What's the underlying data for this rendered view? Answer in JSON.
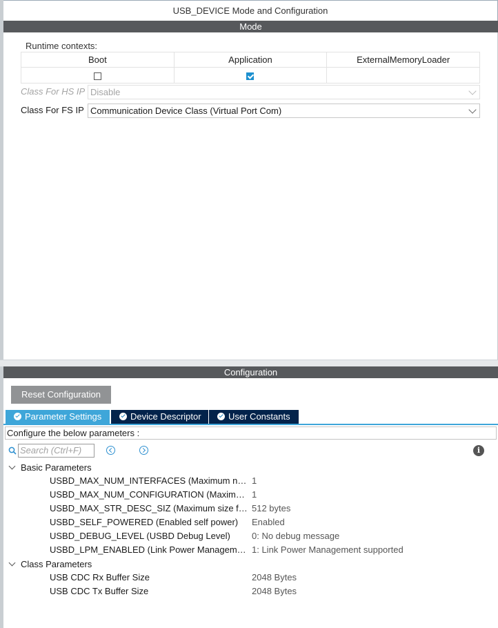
{
  "window": {
    "title": "USB_DEVICE Mode and Configuration"
  },
  "mode": {
    "header": "Mode",
    "runtime_label": "Runtime contexts:",
    "contexts": [
      {
        "label": "Boot",
        "checked": false
      },
      {
        "label": "Application",
        "checked": true
      },
      {
        "label": "ExternalMemoryLoader",
        "checked": null
      }
    ],
    "hs_label": "Class For HS IP",
    "hs_value": "Disable",
    "fs_label": "Class For FS IP",
    "fs_value": "Communication Device Class (Virtual Port Com)"
  },
  "config": {
    "header": "Configuration",
    "reset_label": "Reset Configuration",
    "tabs": [
      {
        "label": "Parameter Settings",
        "active": true
      },
      {
        "label": "Device Descriptor",
        "active": false
      },
      {
        "label": "User Constants",
        "active": false
      }
    ],
    "hint": "Configure the below parameters :",
    "search_placeholder": "Search (Ctrl+F)",
    "groups": [
      {
        "label": "Basic Parameters",
        "rows": [
          {
            "name": "USBD_MAX_NUM_INTERFACES (Maximum number of interfaces)",
            "value": "1"
          },
          {
            "name": "USBD_MAX_NUM_CONFIGURATION (Maximum number of configurations)",
            "value": "1"
          },
          {
            "name": "USBD_MAX_STR_DESC_SIZ (Maximum size for the string descriptors)",
            "value": "512 bytes"
          },
          {
            "name": "USBD_SELF_POWERED (Enabled self power)",
            "value": "Enabled"
          },
          {
            "name": "USBD_DEBUG_LEVEL (USBD Debug Level)",
            "value": "0: No debug message"
          },
          {
            "name": "USBD_LPM_ENABLED (Link Power Management supported)",
            "value": "1: Link Power Management supported"
          }
        ]
      },
      {
        "label": "Class Parameters",
        "rows": [
          {
            "name": "USB CDC Rx Buffer Size",
            "value": "2048 Bytes"
          },
          {
            "name": "USB CDC Tx Buffer Size",
            "value": "2048 Bytes"
          }
        ]
      }
    ]
  },
  "colors": {
    "accent": "#3ea6d9",
    "tab_dark": "#03234b",
    "section_bar": "#57595c"
  }
}
